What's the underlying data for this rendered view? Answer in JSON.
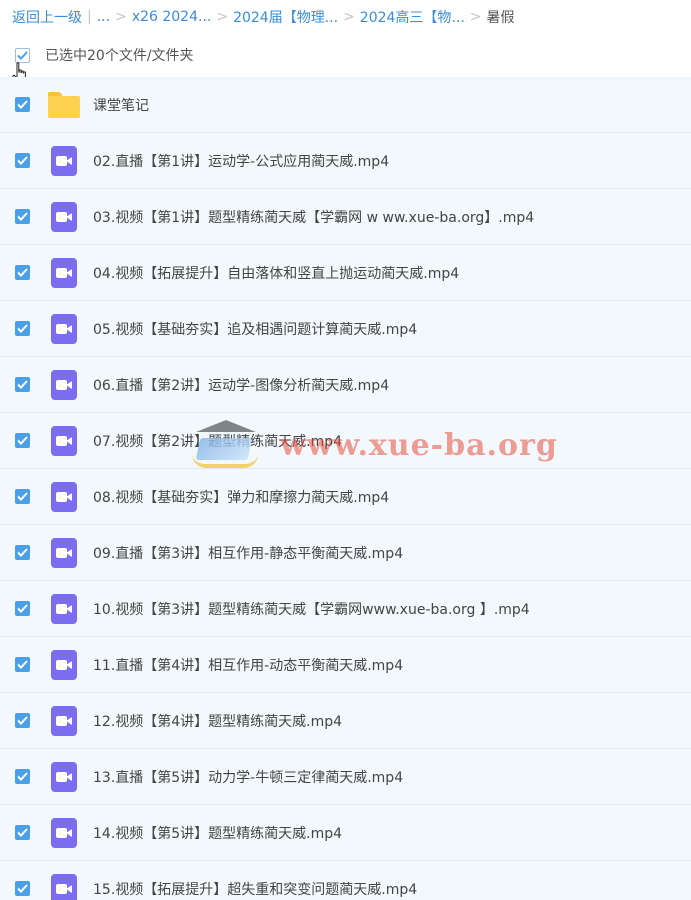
{
  "breadcrumb": {
    "back": "返回上一级",
    "divider": "|",
    "items": [
      "...",
      "x26 2024...",
      "2024届【物理...",
      "2024高三【物..."
    ],
    "current": "暑假"
  },
  "selection": {
    "label": "已选中20个文件/文件夹"
  },
  "files": [
    {
      "type": "folder",
      "name": "课堂笔记"
    },
    {
      "type": "video",
      "name": "02.直播【第1讲】运动学-公式应用蔺天威.mp4"
    },
    {
      "type": "video",
      "name": "03.视频【第1讲】题型精练蔺天威【学霸网 w ww.xue-ba.org】.mp4"
    },
    {
      "type": "video",
      "name": "04.视频【拓展提升】自由落体和竖直上抛运动蔺天威.mp4"
    },
    {
      "type": "video",
      "name": "05.视频【基础夯实】追及相遇问题计算蔺天威.mp4"
    },
    {
      "type": "video",
      "name": "06.直播【第2讲】运动学-图像分析蔺天威.mp4"
    },
    {
      "type": "video",
      "name": "07.视频【第2讲】题型精练蔺天威.mp4"
    },
    {
      "type": "video",
      "name": "08.视频【基础夯实】弹力和摩擦力蔺天威.mp4"
    },
    {
      "type": "video",
      "name": "09.直播【第3讲】相互作用-静态平衡蔺天威.mp4"
    },
    {
      "type": "video",
      "name": "10.视频【第3讲】题型精练蔺天威【学霸网www.xue-ba.org 】.mp4"
    },
    {
      "type": "video",
      "name": "11.直播【第4讲】相互作用-动态平衡蔺天威.mp4"
    },
    {
      "type": "video",
      "name": "12.视频【第4讲】题型精练蔺天威.mp4"
    },
    {
      "type": "video",
      "name": "13.直播【第5讲】动力学-牛顿三定律蔺天威.mp4"
    },
    {
      "type": "video",
      "name": "14.视频【第5讲】题型精练蔺天威.mp4"
    },
    {
      "type": "video",
      "name": "15.视频【拓展提升】超失重和突变问题蔺天威.mp4"
    }
  ],
  "watermark": {
    "text": "www.xue-ba.org"
  },
  "colors": {
    "link": "#3b8cd9",
    "checkbox": "#4a9fe6",
    "row_bg": "#f3f8fd",
    "video_icon": "#7b6cf0",
    "folder_icon": "#fdd04f"
  }
}
